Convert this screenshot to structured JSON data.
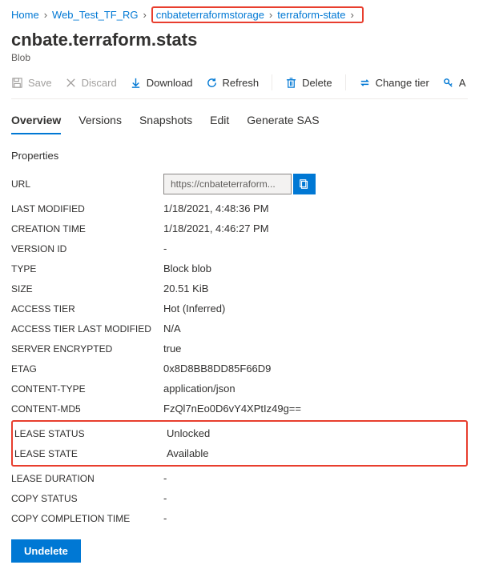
{
  "breadcrumb": {
    "items": [
      "Home",
      "Web_Test_TF_RG",
      "cnbateterraformstorage",
      "terraform-state"
    ]
  },
  "title": "cnbate.terraform.stats",
  "subtitle": "Blob",
  "toolbar": {
    "save": "Save",
    "discard": "Discard",
    "download": "Download",
    "refresh": "Refresh",
    "delete": "Delete",
    "change_tier": "Change tier",
    "acquire": "A"
  },
  "tabs": [
    "Overview",
    "Versions",
    "Snapshots",
    "Edit",
    "Generate SAS"
  ],
  "section_header": "Properties",
  "properties": {
    "url_label": "URL",
    "url_value": "https://cnbateterraform...",
    "last_modified_label": "LAST MODIFIED",
    "last_modified_value": "1/18/2021, 4:48:36 PM",
    "creation_time_label": "CREATION TIME",
    "creation_time_value": "1/18/2021, 4:46:27 PM",
    "version_id_label": "VERSION ID",
    "version_id_value": "-",
    "type_label": "TYPE",
    "type_value": "Block blob",
    "size_label": "SIZE",
    "size_value": "20.51 KiB",
    "access_tier_label": "ACCESS TIER",
    "access_tier_value": "Hot (Inferred)",
    "access_tier_lm_label": "ACCESS TIER LAST MODIFIED",
    "access_tier_lm_value": "N/A",
    "server_encrypted_label": "SERVER ENCRYPTED",
    "server_encrypted_value": "true",
    "etag_label": "ETAG",
    "etag_value": "0x8D8BB8DD85F66D9",
    "content_type_label": "CONTENT-TYPE",
    "content_type_value": "application/json",
    "content_md5_label": "CONTENT-MD5",
    "content_md5_value": "FzQl7nEo0D6vY4XPtIz49g==",
    "lease_status_label": "LEASE STATUS",
    "lease_status_value": "Unlocked",
    "lease_state_label": "LEASE STATE",
    "lease_state_value": "Available",
    "lease_duration_label": "LEASE DURATION",
    "lease_duration_value": "-",
    "copy_status_label": "COPY STATUS",
    "copy_status_value": "-",
    "copy_completion_label": "COPY COMPLETION TIME",
    "copy_completion_value": "-"
  },
  "undelete_label": "Undelete"
}
